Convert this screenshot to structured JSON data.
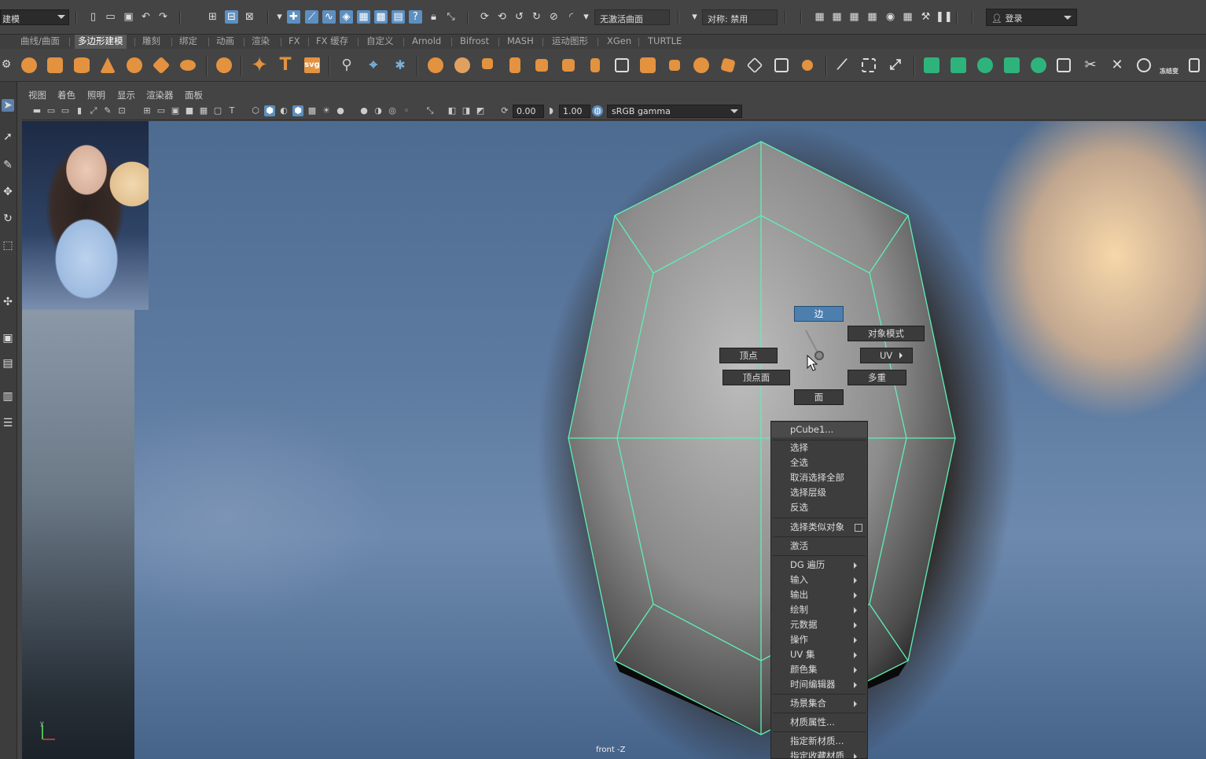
{
  "statusline": {
    "mode_menu": "建模",
    "live_surface": "无激活曲面",
    "symmetry": "对称: 禁用",
    "login": "登录"
  },
  "shelf_tabs": [
    "曲线/曲面",
    "多边形建模",
    "雕刻",
    "绑定",
    "动画",
    "渲染",
    "FX",
    "FX 缓存",
    "自定义",
    "Arnold",
    "Bifrost",
    "MASH",
    "运动图形",
    "XGen",
    "TURTLE"
  ],
  "shelf_active_tab": "多边形建模",
  "shelf_text_icons": {
    "text_tool": "T",
    "svg_tool": "svg",
    "freeze_label": "冻结变"
  },
  "panel_menu": [
    "视图",
    "着色",
    "照明",
    "显示",
    "渲染器",
    "面板"
  ],
  "panel_toolbar": {
    "exposure": "0.00",
    "gamma": "1.00",
    "color_space": "sRGB gamma"
  },
  "viewport": {
    "camera_label": "front -Z",
    "axis_y": "y"
  },
  "marking_menu": {
    "north": "边",
    "northeast": "对象模式",
    "west": "顶点",
    "east": "UV",
    "southwest": "顶点面",
    "southeast": "多重",
    "south": "面"
  },
  "context_menu": {
    "object": "pCube1...",
    "items": [
      "选择",
      "全选",
      "取消选择全部",
      "选择层级",
      "反选"
    ],
    "select_similar": "选择类似对象",
    "activate": "激活",
    "submenus": [
      "DG 遍历",
      "输入",
      "输出",
      "绘制",
      "元数据",
      "操作",
      "UV 集",
      "颜色集",
      "时间编辑器"
    ],
    "scene_assembly": "场景集合",
    "material_attributes": "材质属性...",
    "assign_new_material": "指定新材质...",
    "assign_favorite_material": "指定收藏材质"
  },
  "colors": {
    "accent_blue": "#5d8fc0",
    "mesh_wire": "#5ef0b4",
    "shelf_orange": "#e39240",
    "shelf_green": "#2fb37c"
  }
}
